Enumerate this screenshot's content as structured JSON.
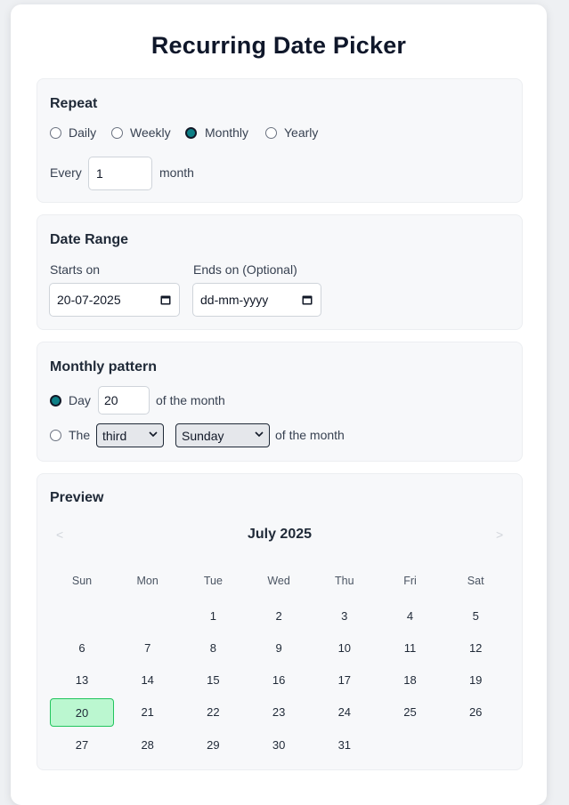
{
  "title": "Recurring Date Picker",
  "repeat": {
    "heading": "Repeat",
    "options": [
      "Daily",
      "Weekly",
      "Monthly",
      "Yearly"
    ],
    "selected": "Monthly",
    "every_label": "Every",
    "every_value": "1",
    "unit": "month"
  },
  "range": {
    "heading": "Date Range",
    "starts_label": "Starts on",
    "starts_value": "20-07-2025",
    "ends_label": "Ends on (Optional)",
    "ends_placeholder": "dd-mm-yyyy"
  },
  "monthly": {
    "heading": "Monthly pattern",
    "day_label": "Day",
    "day_value": "20",
    "of_month": "of the month",
    "the_label": "The",
    "ordinal": "third",
    "weekday": "Sunday",
    "selected_option": "day"
  },
  "preview": {
    "heading": "Preview",
    "month": "July 2025",
    "prev": "<",
    "next": ">",
    "weekdays": [
      "Sun",
      "Mon",
      "Tue",
      "Wed",
      "Thu",
      "Fri",
      "Sat"
    ],
    "first_weekday_index": 2,
    "days_in_month": 31,
    "selected_day": 20
  },
  "colors": {
    "accent": "#0d7f86",
    "selected_day_bg": "#bbf7d0",
    "selected_day_border": "#22c55e"
  }
}
